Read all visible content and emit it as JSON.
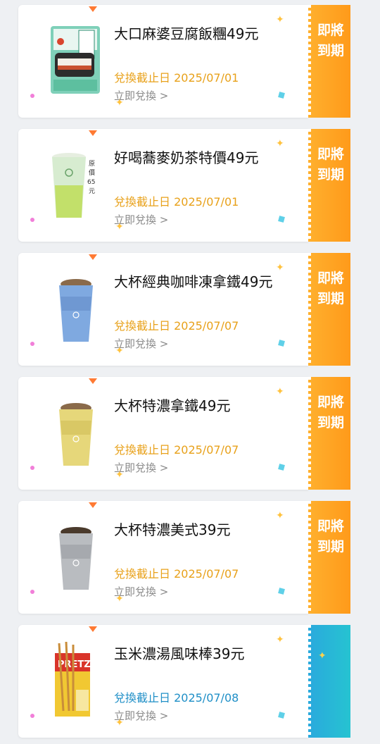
{
  "coupons": [
    {
      "title": "大口麻婆豆腐飯糰49元",
      "deadline": "兌換截止日 2025/07/01",
      "redeem": "立即兌換 >",
      "tab_label": "即將到期",
      "tab_color": "orange",
      "product_icon": "onigiri-pack-icon"
    },
    {
      "title": "好喝蕎麥奶茶特價49元",
      "deadline": "兌換截止日 2025/07/01",
      "redeem": "立即兌換 >",
      "tab_label": "即將到期",
      "tab_color": "orange",
      "product_icon": "milk-tea-cup-icon",
      "badge": "原價65元"
    },
    {
      "title": "大杯經典咖啡凍拿鐵49元",
      "deadline": "兌換截止日 2025/07/07",
      "redeem": "立即兌換 >",
      "tab_label": "即將到期",
      "tab_color": "orange",
      "product_icon": "blue-coffee-cup-icon"
    },
    {
      "title": "大杯特濃拿鐵49元",
      "deadline": "兌換截止日 2025/07/07",
      "redeem": "立即兌換 >",
      "tab_label": "即將到期",
      "tab_color": "orange",
      "product_icon": "yellow-coffee-cup-icon"
    },
    {
      "title": "大杯特濃美式39元",
      "deadline": "兌換截止日 2025/07/07",
      "redeem": "立即兌換 >",
      "tab_label": "即將到期",
      "tab_color": "orange",
      "product_icon": "silver-coffee-cup-icon"
    },
    {
      "title": "玉米濃湯風味棒39元",
      "deadline": "兌換截止日 2025/07/08",
      "redeem": "立即兌換 >",
      "tab_label": "",
      "tab_color": "teal",
      "product_icon": "pretz-box-icon"
    }
  ],
  "colors": {
    "orange_tab": "#ff9a1a",
    "teal_tab": "#26b3d6",
    "deadline_orange": "#e8a11a",
    "deadline_teal": "#1f8fc7"
  }
}
